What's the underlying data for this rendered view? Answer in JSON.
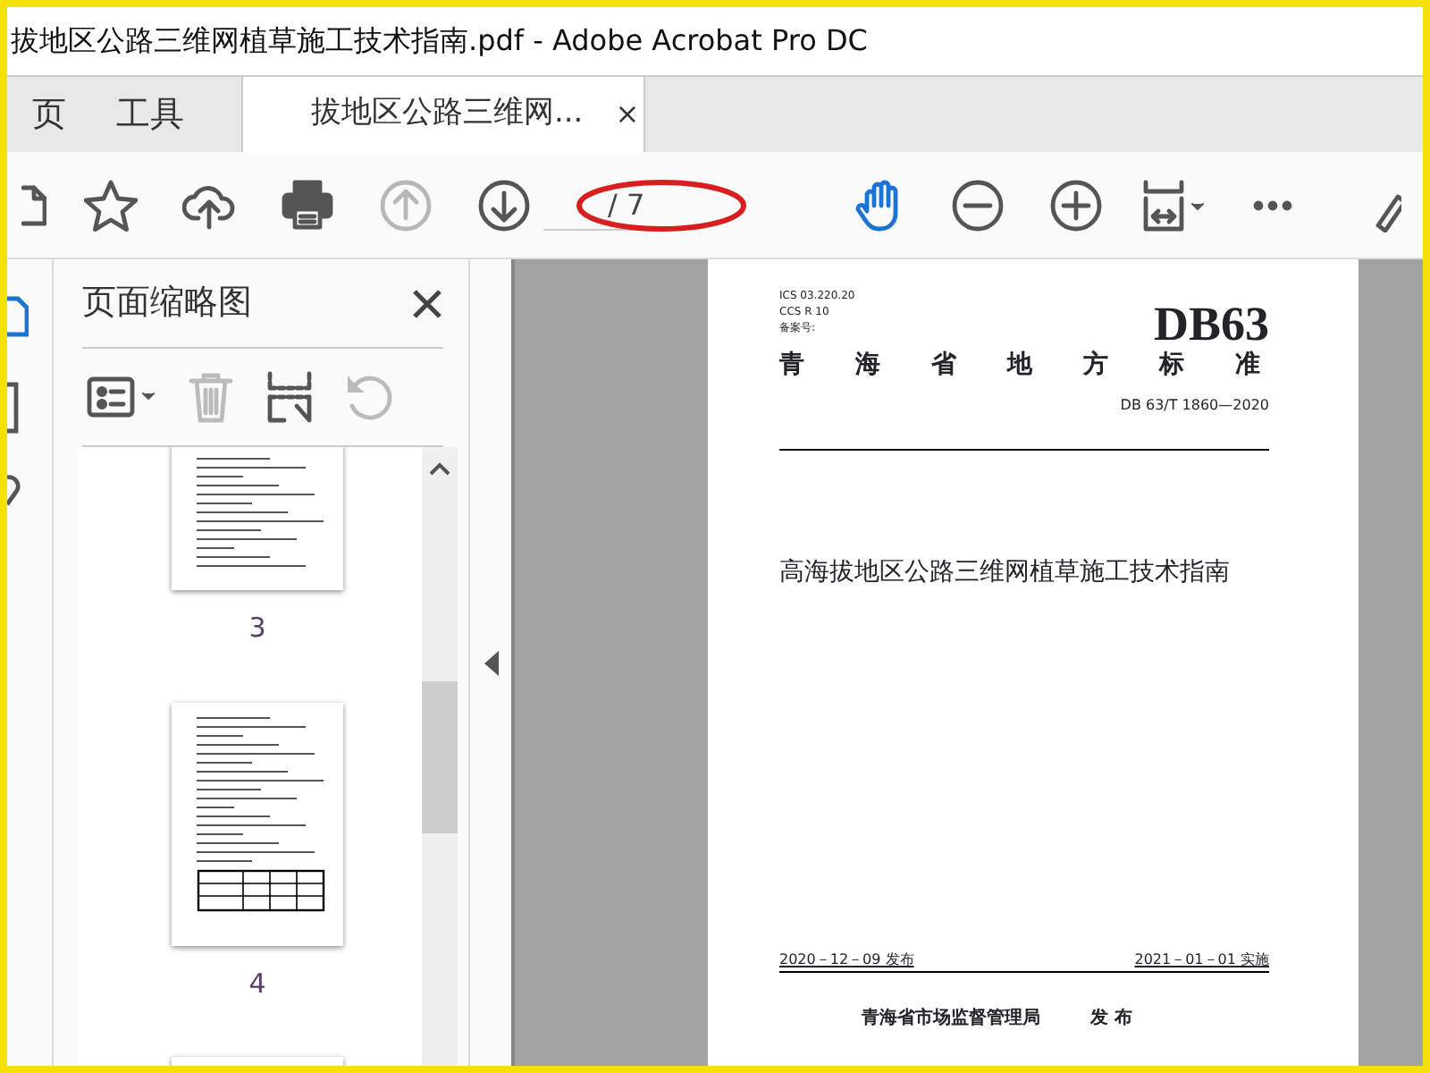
{
  "window": {
    "title": "拔地区公路三维网植草施工技术指南.pdf - Adobe Acrobat Pro DC"
  },
  "tabs": [
    {
      "label": "页",
      "selected": false
    },
    {
      "label": "工具",
      "selected": false
    },
    {
      "label": "拔地区公路三维网...",
      "selected": true,
      "close": "×"
    }
  ],
  "toolbar": {
    "tools": [
      {
        "kind": "page",
        "disabled": false,
        "selected": false
      },
      {
        "kind": "star",
        "disabled": false,
        "selected": false
      },
      {
        "kind": "upload",
        "disabled": false,
        "selected": false
      },
      {
        "kind": "print",
        "disabled": false,
        "selected": false
      },
      {
        "kind": "up",
        "disabled": true,
        "selected": false
      },
      {
        "kind": "down",
        "disabled": false,
        "selected": false
      },
      {
        "kind": "pager"
      },
      {
        "kind": "hand",
        "disabled": false,
        "selected": true
      },
      {
        "kind": "zoomout",
        "disabled": false,
        "selected": false
      },
      {
        "kind": "zoomin",
        "disabled": false,
        "selected": false
      },
      {
        "kind": "fit",
        "disabled": false,
        "selected": false
      },
      {
        "kind": "more",
        "disabled": false,
        "selected": false
      },
      {
        "kind": "pen",
        "disabled": false,
        "selected": false
      }
    ],
    "page_total": "/ 7"
  },
  "sidebar": {
    "title": "页面缩略图",
    "tools": [
      {
        "kind": "options",
        "disabled": false
      },
      {
        "kind": "trash",
        "disabled": true
      },
      {
        "kind": "split",
        "disabled": false
      },
      {
        "kind": "rotate",
        "disabled": true
      }
    ],
    "thumbnails": [
      {
        "page": "3"
      },
      {
        "page": "4"
      }
    ]
  },
  "document": {
    "header_codes": [
      "ICS 03.220.20",
      "CCS R 10",
      "备案号:"
    ],
    "code": "DB63",
    "category": "青海省地方标准",
    "number": "DB 63/T 1860—2020",
    "title": "高海拔地区公路三维网植草施工技术指南",
    "release_date": "2020－12－09 发布",
    "effective_date": "2021－01－01 实施",
    "issuer": "青海省市场监督管理局",
    "issue_word": "发 布"
  }
}
